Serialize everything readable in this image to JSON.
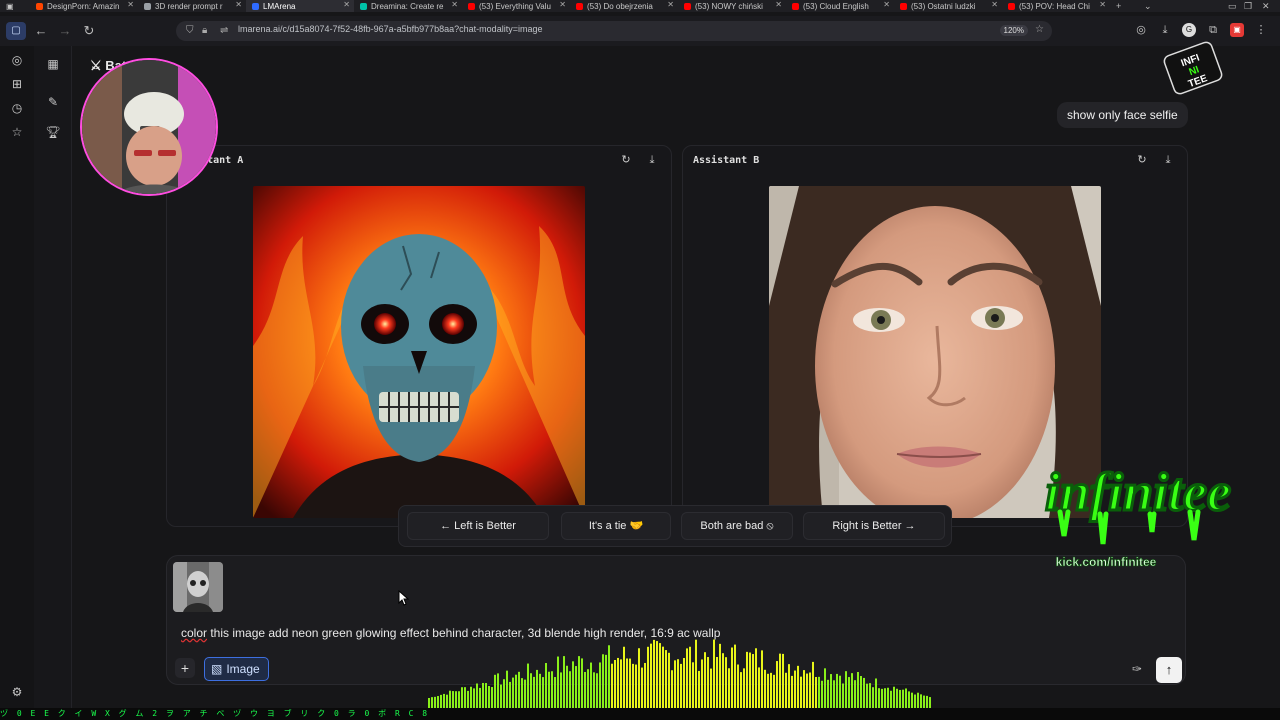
{
  "browser": {
    "tabs": [
      {
        "title": "DesignPorn: Amazin",
        "color": "#ff4500"
      },
      {
        "title": "3D render prompt r",
        "color": "#9aa0a6"
      },
      {
        "title": "LMArena",
        "color": "#2f6bff",
        "active": true
      },
      {
        "title": "Dreamina: Create re",
        "color": "#00c2a8"
      },
      {
        "title": "(53) Everything Valu",
        "color": "#ff0000"
      },
      {
        "title": "(53) Do obejrzenia",
        "color": "#ff0000"
      },
      {
        "title": "(53) NOWY chiński",
        "color": "#ff0000"
      },
      {
        "title": "(53) Cloud English",
        "color": "#ff0000"
      },
      {
        "title": "(53) Ostatni ludzki",
        "color": "#ff0000"
      },
      {
        "title": "(53) POV: Head Chi",
        "color": "#ff0000"
      }
    ],
    "url": "lmarena.ai/c/d15a8074-7f52-48fb-967a-a5bfb977b8aa?chat-modality=image",
    "zoom": "120%"
  },
  "page": {
    "title": "Battl",
    "user_message": "show only face selfie",
    "assistant_a": {
      "label": "Assistant A"
    },
    "assistant_b": {
      "label": "Assistant B"
    }
  },
  "vote": {
    "left": "← Left is Better",
    "tie": "It's a tie 🤝",
    "bad": "Both are bad ⦸",
    "right": "Right is Better →"
  },
  "composer": {
    "prompt_word1": "color",
    "prompt_rest": " this image add neon green glowing effect behind character, 3d blende  high render, 16:9 ac  wallp",
    "image_label": "Image"
  },
  "overlay": {
    "brand": "infinitee",
    "link": "kick.com/infinitee",
    "small_logo": "INFI NI TEE"
  },
  "ticker": "ヅ  0   E E ク イ W X グ    ム               2  ヲ   ア チ ベ ヅ          ウ ヨ ブ リ           ク               0   ラ   0  ボ R C 8",
  "colors": {
    "accent": "#3d6fe0",
    "neon": "#39ff14",
    "cam_ring": "#ff4de1"
  }
}
